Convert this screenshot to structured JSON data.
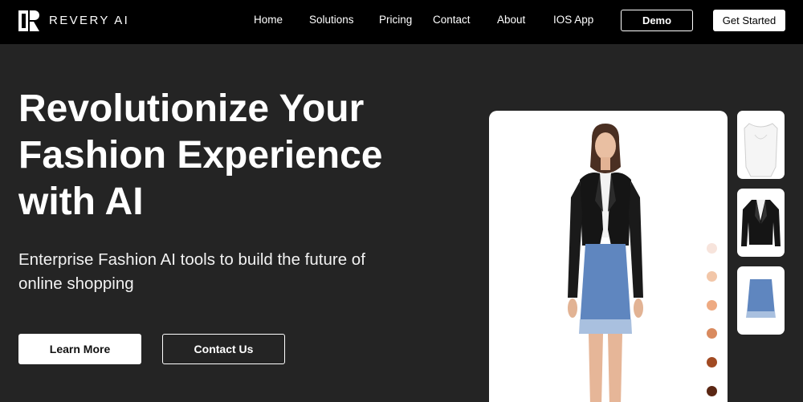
{
  "brand": {
    "name": "REVERY AI"
  },
  "nav": {
    "links": [
      "Home",
      "Solutions",
      "Pricing",
      "Contact",
      "About",
      "IOS App"
    ],
    "demo_label": "Demo",
    "get_started_label": "Get Started"
  },
  "hero": {
    "title_lines": [
      "Revolutionize Your",
      "Fashion Experience",
      "with AI"
    ],
    "subtitle_lines": [
      "Enterprise Fashion AI tools to build the future of",
      "online shopping"
    ],
    "learn_more_label": "Learn More",
    "contact_us_label": "Contact Us"
  },
  "product": {
    "skin_tone_swatches": [
      "#f7e4dc",
      "#f2c6a8",
      "#eeaa82",
      "#d98a5e",
      "#a14a22",
      "#5a2613"
    ],
    "thumbnails": [
      "white-corset-top",
      "black-leather-jacket",
      "blue-tweed-skirt"
    ]
  },
  "colors": {
    "background": "#242424",
    "header": "#000000",
    "accent": "#ffffff"
  }
}
